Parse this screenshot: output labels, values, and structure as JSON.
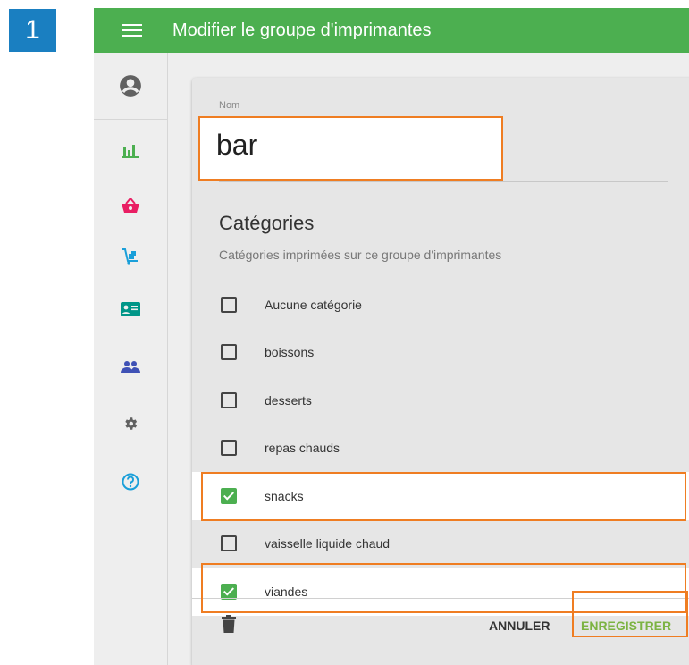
{
  "step_number": "1",
  "header": {
    "title": "Modifier le groupe d'imprimantes"
  },
  "sidebar": {
    "items": [
      {
        "icon": "account-circle-icon",
        "color": "#616161"
      },
      {
        "icon": "bar-chart-icon",
        "color": "#4caf50"
      },
      {
        "icon": "basket-icon",
        "color": "#e91e63"
      },
      {
        "icon": "delivery-cart-icon",
        "color": "#1a9fd9"
      },
      {
        "icon": "id-card-icon",
        "color": "#009688"
      },
      {
        "icon": "people-icon",
        "color": "#3f51b5"
      },
      {
        "icon": "gear-icon",
        "color": "#616161"
      },
      {
        "icon": "help-icon",
        "color": "#1a9fd9"
      }
    ]
  },
  "form": {
    "name_label": "Nom",
    "name_value": "bar",
    "categories_title": "Catégories",
    "categories_subtitle": "Catégories imprimées sur ce groupe d'imprimantes",
    "categories": [
      {
        "label": "Aucune catégorie",
        "checked": false
      },
      {
        "label": "boissons",
        "checked": false
      },
      {
        "label": "desserts",
        "checked": false
      },
      {
        "label": "repas chauds",
        "checked": false
      },
      {
        "label": "snacks",
        "checked": true
      },
      {
        "label": "vaisselle liquide chaud",
        "checked": false
      },
      {
        "label": "viandes",
        "checked": true
      }
    ]
  },
  "footer": {
    "cancel_label": "ANNULER",
    "save_label": "ENREGISTRER"
  },
  "colors": {
    "primary": "#4caf50",
    "highlight": "#ef7d22",
    "step_badge": "#1a7fc1"
  }
}
